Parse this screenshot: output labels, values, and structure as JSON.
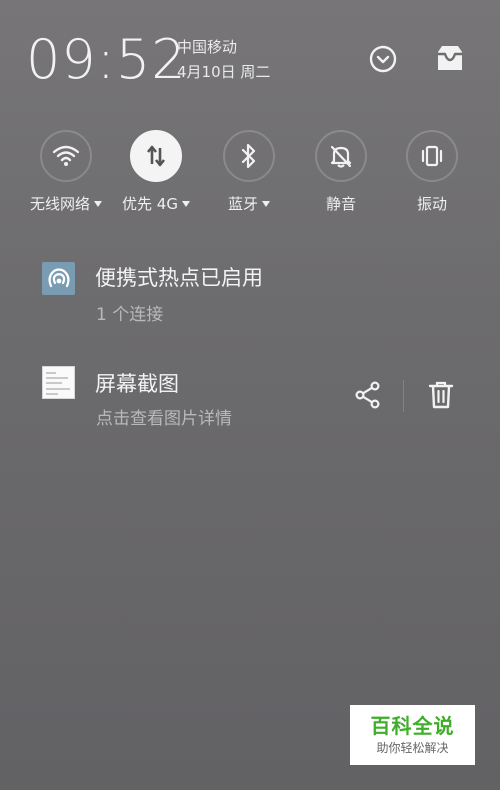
{
  "status": {
    "time": "09:52",
    "carrier": "中国移动",
    "date": "4月10日 周二"
  },
  "header_actions": {
    "expand_icon": "chevron-down-circle-icon",
    "tray_icon": "inbox-tray-icon"
  },
  "toggles": [
    {
      "label": "无线网络",
      "icon": "wifi-icon",
      "active": false,
      "has_menu": true
    },
    {
      "label": "优先 4G",
      "icon": "data-transfer-icon",
      "active": true,
      "has_menu": true
    },
    {
      "label": "蓝牙",
      "icon": "bluetooth-icon",
      "active": false,
      "has_menu": true
    },
    {
      "label": "静音",
      "icon": "bell-off-icon",
      "active": false,
      "has_menu": false
    },
    {
      "label": "振动",
      "icon": "vibrate-icon",
      "active": false,
      "has_menu": false
    }
  ],
  "notifications": [
    {
      "title": "便携式热点已启用",
      "subtitle": "1 个连接",
      "icon": "hotspot-icon"
    },
    {
      "title": "屏幕截图",
      "subtitle": "点击查看图片详情",
      "icon": "screenshot-thumbnail",
      "actions": [
        "share-icon",
        "trash-icon"
      ]
    }
  ],
  "watermark": {
    "main": "百科全说",
    "sub": "助你轻松解决"
  },
  "colors": {
    "background": "#6c6b6d",
    "active_toggle": "#f4f4f4",
    "hotspot_icon_bg": "#7a9cb3",
    "watermark_green": "#3fae2a"
  }
}
